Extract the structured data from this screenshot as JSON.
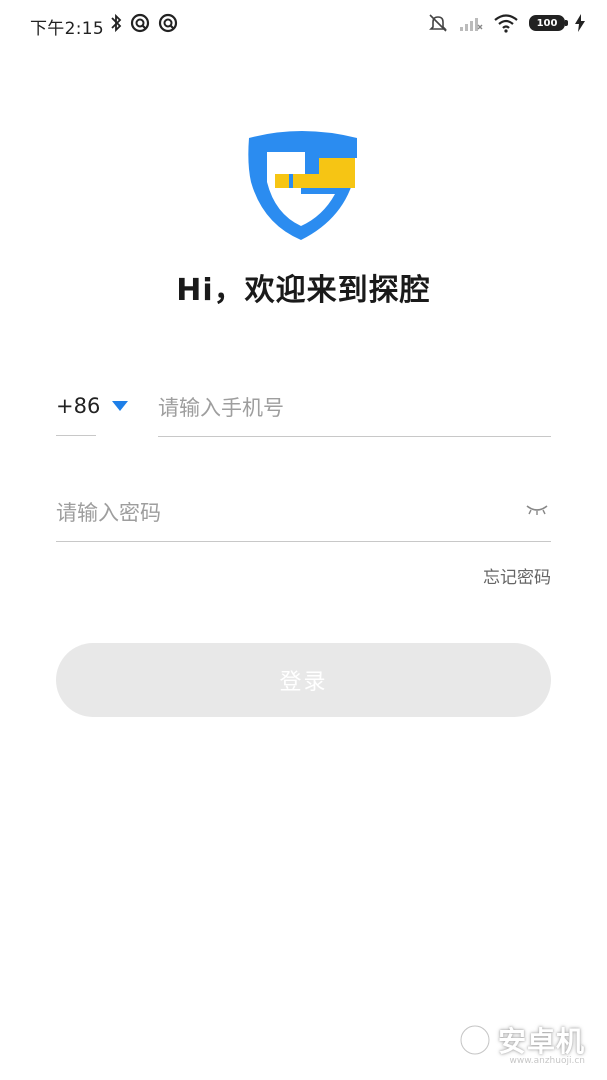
{
  "status_bar": {
    "time": "下午2:15",
    "battery": "100",
    "icons": [
      "bluetooth-icon",
      "sync-icon",
      "sync-icon",
      "mute-icon",
      "signal-icon",
      "wifi-icon",
      "battery-icon",
      "charging-icon"
    ]
  },
  "app": {
    "welcome": "Hi，欢迎来到探腔",
    "colors": {
      "brand_blue": "#2b8cf0",
      "brand_yellow": "#f6c514",
      "caret": "#1e7fe8"
    }
  },
  "form": {
    "country_code": "+86",
    "phone_placeholder": "请输入手机号",
    "phone_value": "",
    "password_placeholder": "请输入密码",
    "password_value": "",
    "forgot_password": "忘记密码",
    "login_label": "登录"
  },
  "watermark": {
    "text": "安卓机",
    "url": "www.anzhuoji.cn"
  }
}
